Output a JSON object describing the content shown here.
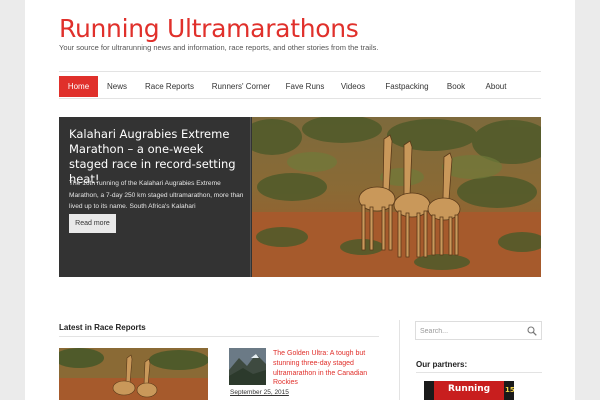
{
  "site": {
    "title": "Running Ultramarathons",
    "tagline": "Your source for ultrarunning news and information, race reports, and other stories from the trails."
  },
  "nav": {
    "items": [
      {
        "label": "Home",
        "active": true
      },
      {
        "label": "News",
        "active": false
      },
      {
        "label": "Race Reports",
        "active": false
      },
      {
        "label": "Runners' Corner",
        "active": false
      },
      {
        "label": "Fave Runs",
        "active": false
      },
      {
        "label": "Videos",
        "active": false
      },
      {
        "label": "Fastpacking",
        "active": false
      },
      {
        "label": "Book",
        "active": false
      },
      {
        "label": "About",
        "active": false
      }
    ]
  },
  "featured": {
    "title": "Kalahari Augrabies Extreme Marathon – a one-week staged race in record-setting heat!",
    "excerpt": "The 16th running of the Kalahari Augrabies Extreme Marathon, a 7-day 250 km staged ultramarathon, more than lived up to its name. South Africa's Kalahari",
    "read_more": "Read more"
  },
  "latest": {
    "heading": "Latest in Race Reports",
    "post_title": "The Golden Ultra: A tough but stunning three-day staged ultramarathon in the Canadian Rockies",
    "post_date": "September 25, 2015"
  },
  "sidebar": {
    "search_placeholder": "Search...",
    "partners_heading": "Our partners:",
    "banner_text": "Running",
    "banner_side": "15"
  },
  "colors": {
    "accent": "#e0302b",
    "panel": "#333333"
  },
  "icons": {
    "search": "magnifier-icon"
  }
}
